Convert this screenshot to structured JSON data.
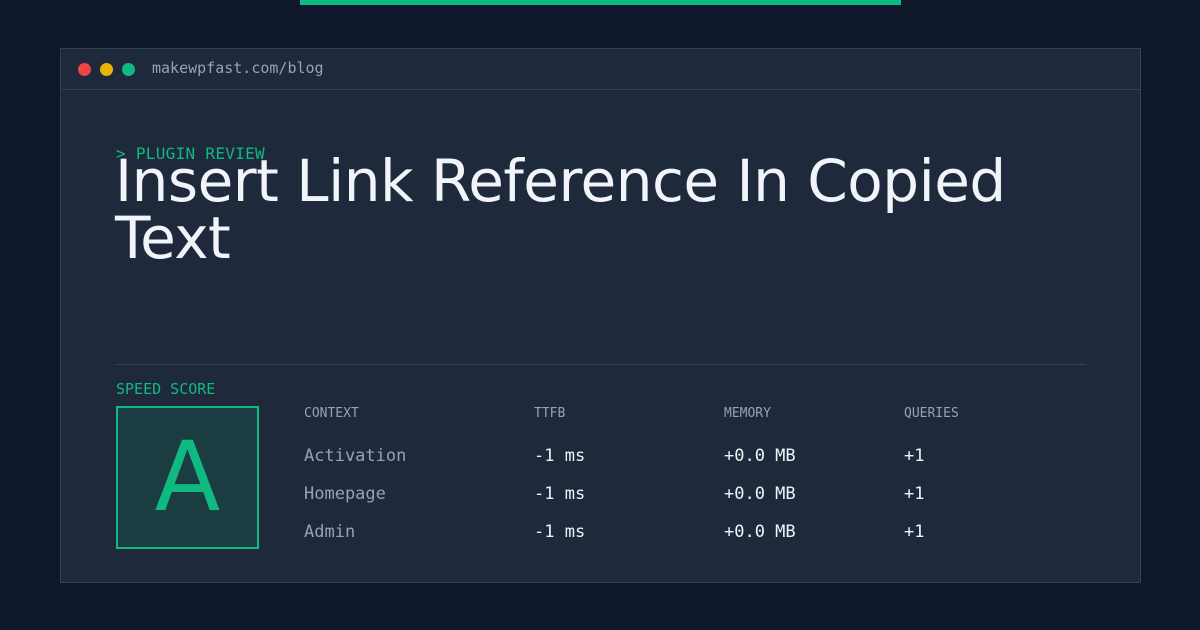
{
  "browser": {
    "url": "makewpfast.com/blog"
  },
  "article": {
    "kicker": "> PLUGIN REVIEW",
    "title": "Insert Link Reference In Copied Text"
  },
  "speed": {
    "label": "SPEED SCORE",
    "grade": "A"
  },
  "stats_table": {
    "headers": [
      "CONTEXT",
      "TTFB",
      "MEMORY",
      "QUERIES"
    ],
    "rows": [
      [
        "Activation",
        "-1 ms",
        "+0.0 MB",
        "+1"
      ],
      [
        "Homepage",
        "-1 ms",
        "+0.0 MB",
        "+1"
      ],
      [
        "Admin",
        "-1 ms",
        "+0.0 MB",
        "+1"
      ]
    ]
  },
  "colors": {
    "accent": "#10b981",
    "window_bg": "#1e293b",
    "page_bg": "#0f172a",
    "dot_red": "#ef4444",
    "dot_yellow": "#eab308",
    "dot_green": "#10b981"
  }
}
